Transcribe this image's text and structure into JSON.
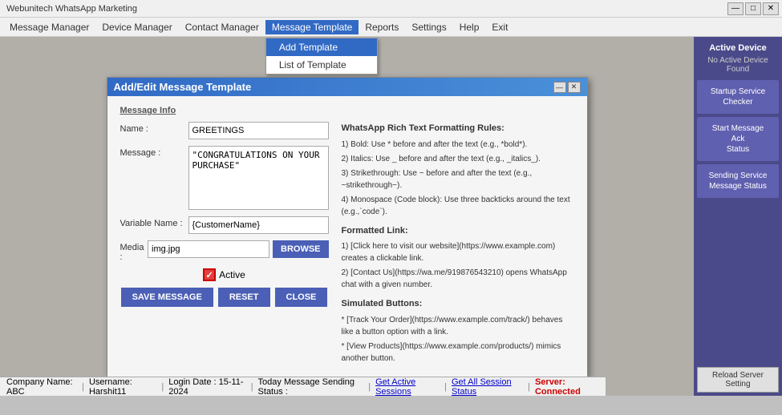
{
  "app": {
    "title": "Webunitech WhatsApp Marketing",
    "title_controls": {
      "minimize": "—",
      "maximize": "□",
      "close": "✕"
    }
  },
  "menu": {
    "items": [
      {
        "label": "Message Manager",
        "active": false
      },
      {
        "label": "Device Manager",
        "active": false
      },
      {
        "label": "Contact Manager",
        "active": false
      },
      {
        "label": "Message Template",
        "active": true,
        "has_dropdown": true
      },
      {
        "label": "Reports",
        "active": false
      },
      {
        "label": "Settings",
        "active": false
      },
      {
        "label": "Help",
        "active": false
      },
      {
        "label": "Exit",
        "active": false
      }
    ],
    "dropdown": {
      "items": [
        {
          "label": "Add Template",
          "selected": true
        },
        {
          "label": "List of Template",
          "selected": false
        }
      ]
    }
  },
  "right_panel": {
    "active_device_title": "Active Device",
    "active_device_subtitle": "No Active Device Found",
    "buttons": [
      {
        "label": "Startup Service\nChecker",
        "key": "startup-service"
      },
      {
        "label": "Start Message\nAck\nStatus",
        "key": "start-message-ack"
      },
      {
        "label": "Sending Service\nMessage Status",
        "key": "sending-service"
      }
    ],
    "reload_label": "Reload Server Setting"
  },
  "dialog": {
    "title": "Add/Edit Message Template",
    "minimize": "—",
    "close": "✕",
    "section_title": "Message Info",
    "name_label": "Name :",
    "name_value": "GREETINGS",
    "message_label": "Message :",
    "message_value": "\"CONGRATULATIONS ON YOUR PURCHASE\"",
    "variable_label": "Variable Name :",
    "variable_value": "{CustomerName}",
    "media_label": "Media :",
    "media_value": "img.jpg",
    "browse_label": "BROWSE",
    "active_label": "Active",
    "buttons": {
      "save": "SAVE MESSAGE",
      "reset": "RESET",
      "close": "CLOSE"
    },
    "formatting": {
      "title": "WhatsApp Rich Text Formatting Rules:",
      "rules": [
        "1) Bold: Use * before and after the text (e.g., *bold*).",
        "2) Italics: Use _ before and after the text (e.g., _italics_).",
        "3) Strikethrough: Use ~ before and after the text (e.g., ~strikethrough~).",
        "4) Monospace (Code block): Use three backticks around the text (e.g.,`code`)."
      ],
      "formatted_link_title": "Formatted Link:",
      "formatted_link_rules": [
        "1) [Click here to visit our website](https://www.example.com) creates a clickable link.",
        "2) [Contact Us](https://wa.me/919876543210) opens WhatsApp chat with a given number."
      ],
      "simulated_buttons_title": "Simulated Buttons:",
      "simulated_buttons_rules": [
        "* [Track Your Order](https://www.example.com/track/) behaves like a button option with a link.",
        "* [View Products](https://www.example.com/products/) mimics another button."
      ]
    }
  },
  "status_bar": {
    "company": "Company Name:  ABC",
    "username": "Username: Harshit11",
    "login_date": "Login Date :  15-11-2024",
    "message_status": "Today Message Sending Status :",
    "get_active_sessions": "Get Active Sessions",
    "get_all_session": "Get All Session Status",
    "server_status": "Server: Connected"
  }
}
